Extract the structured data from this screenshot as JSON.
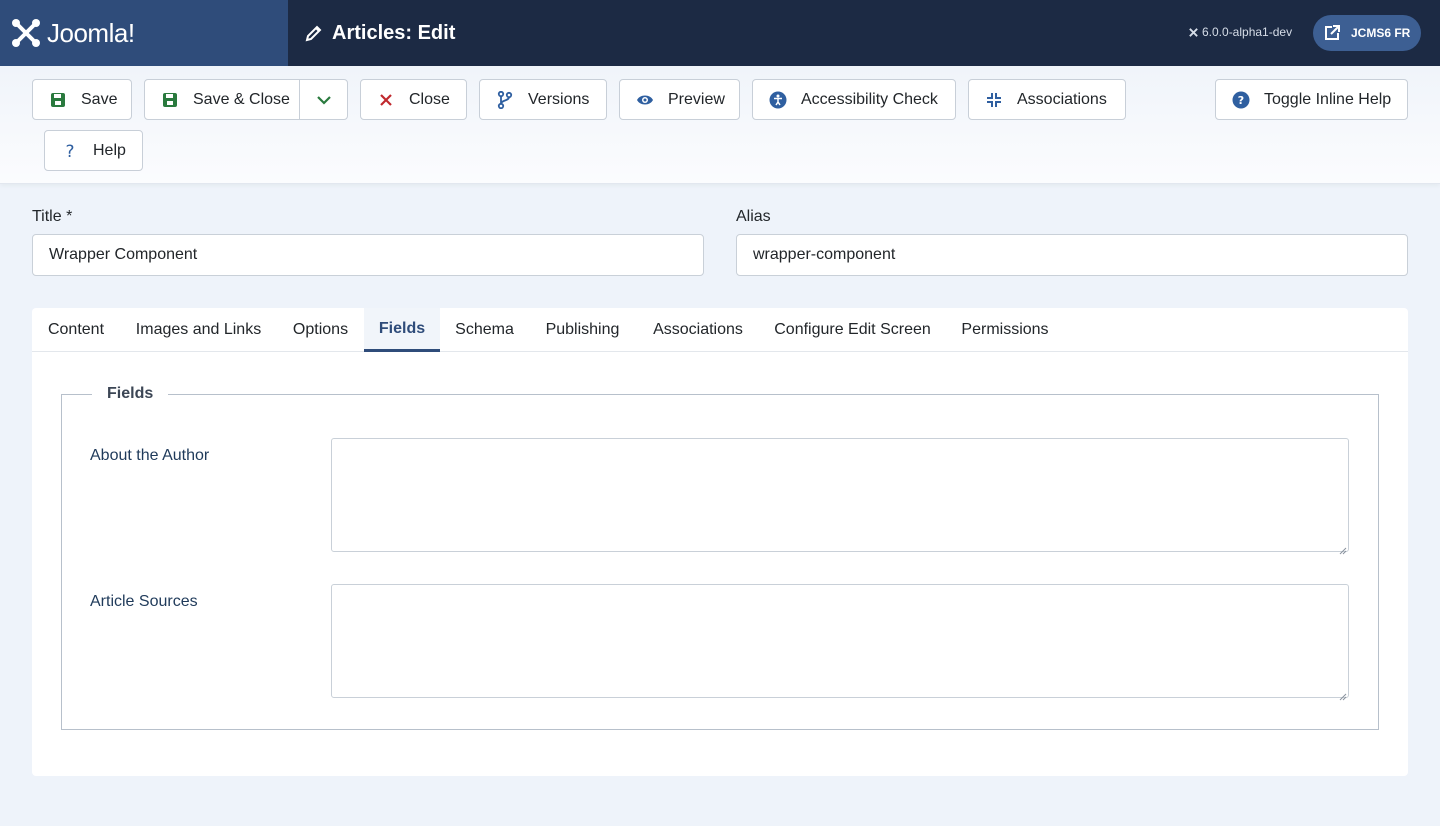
{
  "header": {
    "brand": "Joomla!",
    "page_title": "Articles: Edit",
    "version": "6.0.0-alpha1-dev",
    "user_button": "JCMS6 FR"
  },
  "toolbar": {
    "save": "Save",
    "save_close": "Save & Close",
    "close": "Close",
    "versions": "Versions",
    "preview": "Preview",
    "accessibility": "Accessibility Check",
    "associations": "Associations",
    "toggle_help": "Toggle Inline Help",
    "help": "Help"
  },
  "form": {
    "title_label": "Title *",
    "title_value": "Wrapper Component",
    "alias_label": "Alias",
    "alias_value": "wrapper-component"
  },
  "tabs": [
    {
      "label": "Content"
    },
    {
      "label": "Images and Links"
    },
    {
      "label": "Options"
    },
    {
      "label": "Fields",
      "active": true
    },
    {
      "label": "Schema"
    },
    {
      "label": "Publishing"
    },
    {
      "label": "Associations"
    },
    {
      "label": "Configure Edit Screen"
    },
    {
      "label": "Permissions"
    }
  ],
  "fields_panel": {
    "legend": "Fields",
    "about_author_label": "About the Author",
    "about_author_value": "",
    "article_sources_label": "Article Sources",
    "article_sources_value": ""
  },
  "colors": {
    "header_bg": "#1c2a44",
    "brand_bg": "#2f4c7a",
    "accent": "#2f4c7a",
    "save_icon": "#2a7a3e",
    "close_icon": "#c0282d",
    "icon_blue": "#2f5fa0"
  }
}
